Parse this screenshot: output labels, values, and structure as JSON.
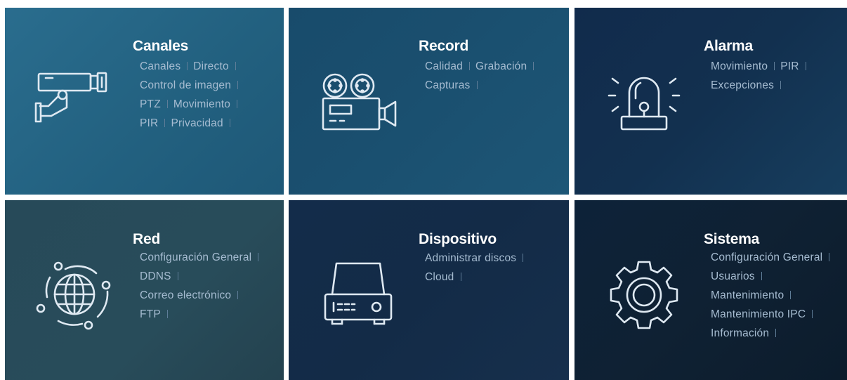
{
  "tiles": {
    "canales": {
      "title": "Canales",
      "icon": "cctv-camera-icon",
      "rows": [
        [
          "Canales",
          "Directo"
        ],
        [
          "Control de imagen"
        ],
        [
          "PTZ",
          "Movimiento"
        ],
        [
          "PIR",
          "Privacidad"
        ]
      ]
    },
    "record": {
      "title": "Record",
      "icon": "video-camera-icon",
      "rows": [
        [
          "Calidad",
          "Grabación"
        ],
        [
          "Capturas"
        ]
      ]
    },
    "alarma": {
      "title": "Alarma",
      "icon": "siren-icon",
      "rows": [
        [
          "Movimiento",
          "PIR"
        ],
        [
          "Excepciones"
        ]
      ]
    },
    "red": {
      "title": "Red",
      "icon": "globe-network-icon",
      "rows": [
        [
          "Configuración General"
        ],
        [
          "DDNS"
        ],
        [
          "Correo electrónico"
        ],
        [
          "FTP"
        ]
      ]
    },
    "dispositivo": {
      "title": "Dispositivo",
      "icon": "hard-drive-icon",
      "rows": [
        [
          "Administrar discos"
        ],
        [
          "Cloud"
        ]
      ]
    },
    "sistema": {
      "title": "Sistema",
      "icon": "gear-icon",
      "rows": [
        [
          "Configuración General"
        ],
        [
          "Usuarios"
        ],
        [
          "Mantenimiento"
        ],
        [
          "Mantenimiento IPC"
        ],
        [
          "Información"
        ]
      ]
    }
  },
  "colors": {
    "title": "#ffffff",
    "item": "#a6bcd1",
    "separator": "#5f7d98",
    "icon": "#dfe9f2"
  }
}
